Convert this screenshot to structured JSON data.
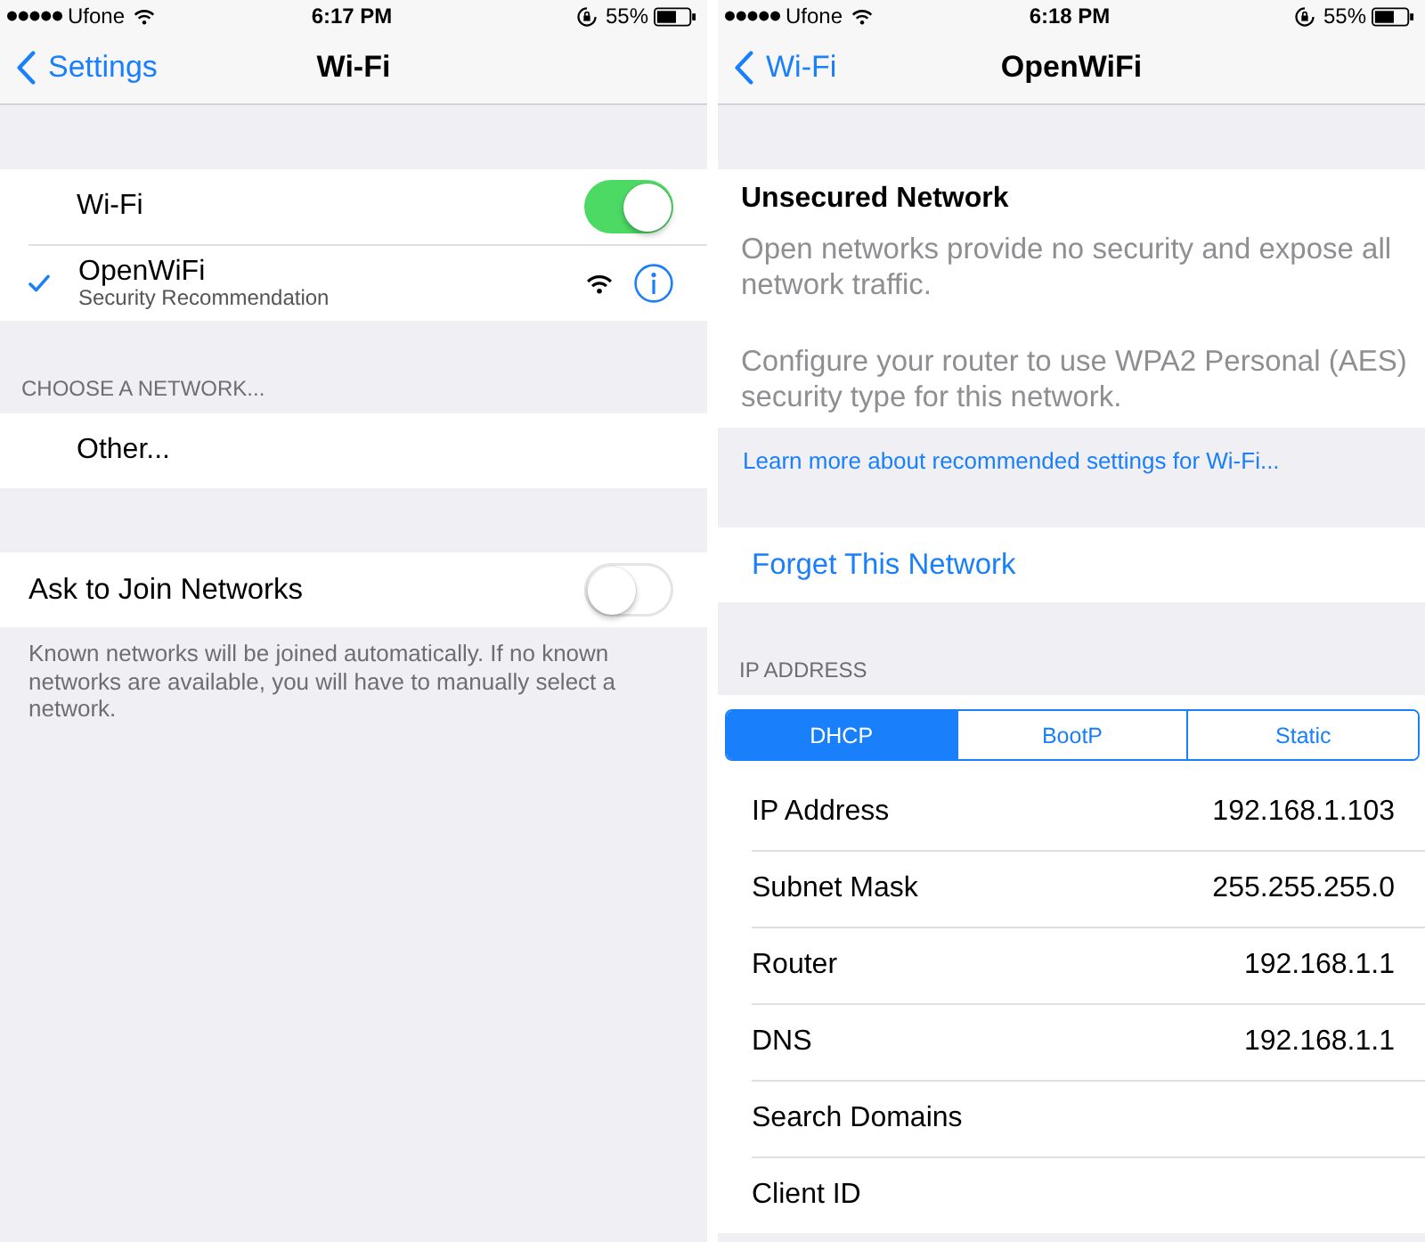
{
  "screens": [
    {
      "status_bar": {
        "carrier": "Ufone",
        "time": "6:17 PM",
        "battery": "55%"
      },
      "nav_bar": {
        "back_label": "Settings",
        "title": "Wi-Fi"
      },
      "sections": [
        {
          "rows": [
            {
              "kind": "master-toggle",
              "label": "Wi-Fi",
              "on": true
            },
            {
              "kind": "network",
              "label": "OpenWiFi",
              "subtitle": "Security Recommendation",
              "selected": true
            }
          ]
        },
        {
          "header": "CHOOSE A NETWORK...",
          "rows": [
            {
              "kind": "option",
              "label": "Other..."
            }
          ]
        },
        {
          "rows": [
            {
              "kind": "toggle",
              "label": "Ask to Join Networks",
              "on": false
            }
          ],
          "footer": {
            "kind": "note",
            "text": "Known networks will be joined automatically. If no known networks are available, you will have to manually select a network."
          }
        }
      ]
    },
    {
      "status_bar": {
        "carrier": "Ufone",
        "time": "6:18 PM",
        "battery": "55%"
      },
      "nav_bar": {
        "back_label": "Wi-Fi",
        "title": "OpenWiFi"
      },
      "sections": [
        {
          "rows": [
            {
              "kind": "notice",
              "title": "Unsecured Network",
              "paragraphs": [
                "Open networks provide no security and expose all network traffic.",
                "Configure your router to use WPA2 Personal (AES) security type for this network."
              ]
            }
          ],
          "footer": {
            "kind": "link",
            "text": "Learn more about recommended settings for Wi-Fi..."
          }
        },
        {
          "rows": [
            {
              "kind": "action",
              "label": "Forget This Network"
            }
          ]
        },
        {
          "header": "IP ADDRESS",
          "rows": [
            {
              "kind": "segmented",
              "segments": [
                {
                  "label": "DHCP",
                  "selected": true
                },
                {
                  "label": "BootP",
                  "selected": false
                },
                {
                  "label": "Static",
                  "selected": false
                }
              ]
            },
            {
              "kind": "detail",
              "label": "IP Address",
              "value": "192.168.1.103"
            },
            {
              "kind": "detail",
              "label": "Subnet Mask",
              "value": "255.255.255.0"
            },
            {
              "kind": "detail",
              "label": "Router",
              "value": "192.168.1.1"
            },
            {
              "kind": "detail",
              "label": "DNS",
              "value": "192.168.1.1"
            },
            {
              "kind": "detail",
              "label": "Search Domains"
            },
            {
              "kind": "detail",
              "label": "Client ID"
            }
          ]
        }
      ]
    }
  ]
}
